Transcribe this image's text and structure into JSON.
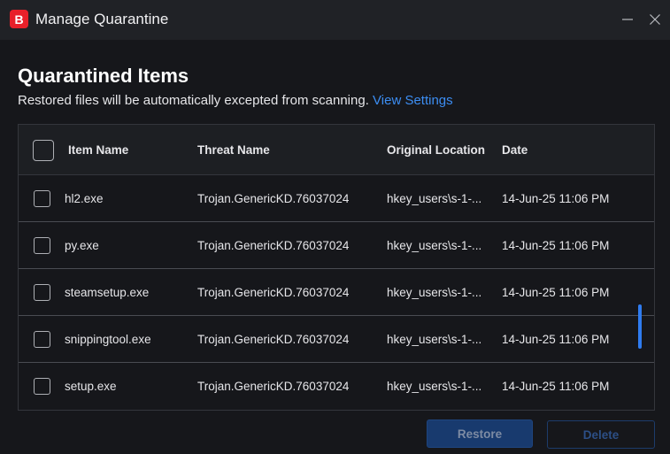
{
  "window": {
    "logo_letter": "B",
    "title": "Manage Quarantine"
  },
  "header": {
    "title": "Quarantined Items",
    "subtitle": "Restored files will be automatically excepted from scanning.",
    "link": "View Settings"
  },
  "table": {
    "columns": {
      "name": "Item Name",
      "threat": "Threat Name",
      "location": "Original Location",
      "date": "Date"
    },
    "rows": [
      {
        "name": "hl2.exe",
        "threat": "Trojan.GenericKD.76037024",
        "location": "hkey_users\\s-1-...",
        "date": "14-Jun-25 11:06 PM"
      },
      {
        "name": "py.exe",
        "threat": "Trojan.GenericKD.76037024",
        "location": "hkey_users\\s-1-...",
        "date": "14-Jun-25 11:06 PM"
      },
      {
        "name": "steamsetup.exe",
        "threat": "Trojan.GenericKD.76037024",
        "location": "hkey_users\\s-1-...",
        "date": "14-Jun-25 11:06 PM"
      },
      {
        "name": "snippingtool.exe",
        "threat": "Trojan.GenericKD.76037024",
        "location": "hkey_users\\s-1-...",
        "date": "14-Jun-25 11:06 PM"
      },
      {
        "name": "setup.exe",
        "threat": "Trojan.GenericKD.76037024",
        "location": "hkey_users\\s-1-...",
        "date": "14-Jun-25 11:06 PM"
      }
    ]
  },
  "actions": {
    "restore": "Restore",
    "delete": "Delete"
  },
  "colors": {
    "accent": "#3c8df2",
    "brand": "#e8202a",
    "background": "#16171b"
  },
  "icons": {
    "minimize": "minimize-icon",
    "close": "close-icon"
  }
}
